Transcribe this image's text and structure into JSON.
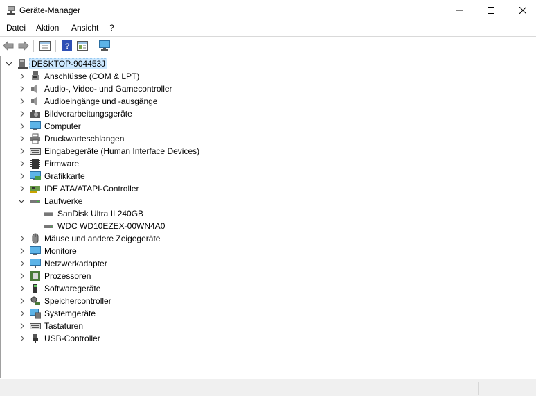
{
  "window": {
    "title": "Geräte-Manager"
  },
  "menu": [
    "Datei",
    "Aktion",
    "Ansicht",
    "?"
  ],
  "toolbar": {
    "buttons": [
      "back-icon",
      "forward-icon",
      "properties-view-icon",
      "help-icon",
      "action-view-icon",
      "monitor-scan-icon"
    ]
  },
  "tree": {
    "root": "DESKTOP-904453J",
    "categories": [
      "Anschlüsse (COM & LPT)",
      "Audio-, Video- und Gamecontroller",
      "Audioeingänge und -ausgänge",
      "Bildverarbeitungsgeräte",
      "Computer",
      "Druckwarteschlangen",
      "Eingabegeräte (Human Interface Devices)",
      "Firmware",
      "Grafikkarte",
      "IDE ATA/ATAPI-Controller",
      "Laufwerke",
      "Mäuse und andere Zeigegeräte",
      "Monitore",
      "Netzwerkadapter",
      "Prozessoren",
      "Softwaregeräte",
      "Speichercontroller",
      "Systemgeräte",
      "Tastaturen",
      "USB-Controller"
    ],
    "drives": [
      "SanDisk Ultra II 240GB",
      "WDC WD10EZEX-00WN4A0"
    ]
  }
}
